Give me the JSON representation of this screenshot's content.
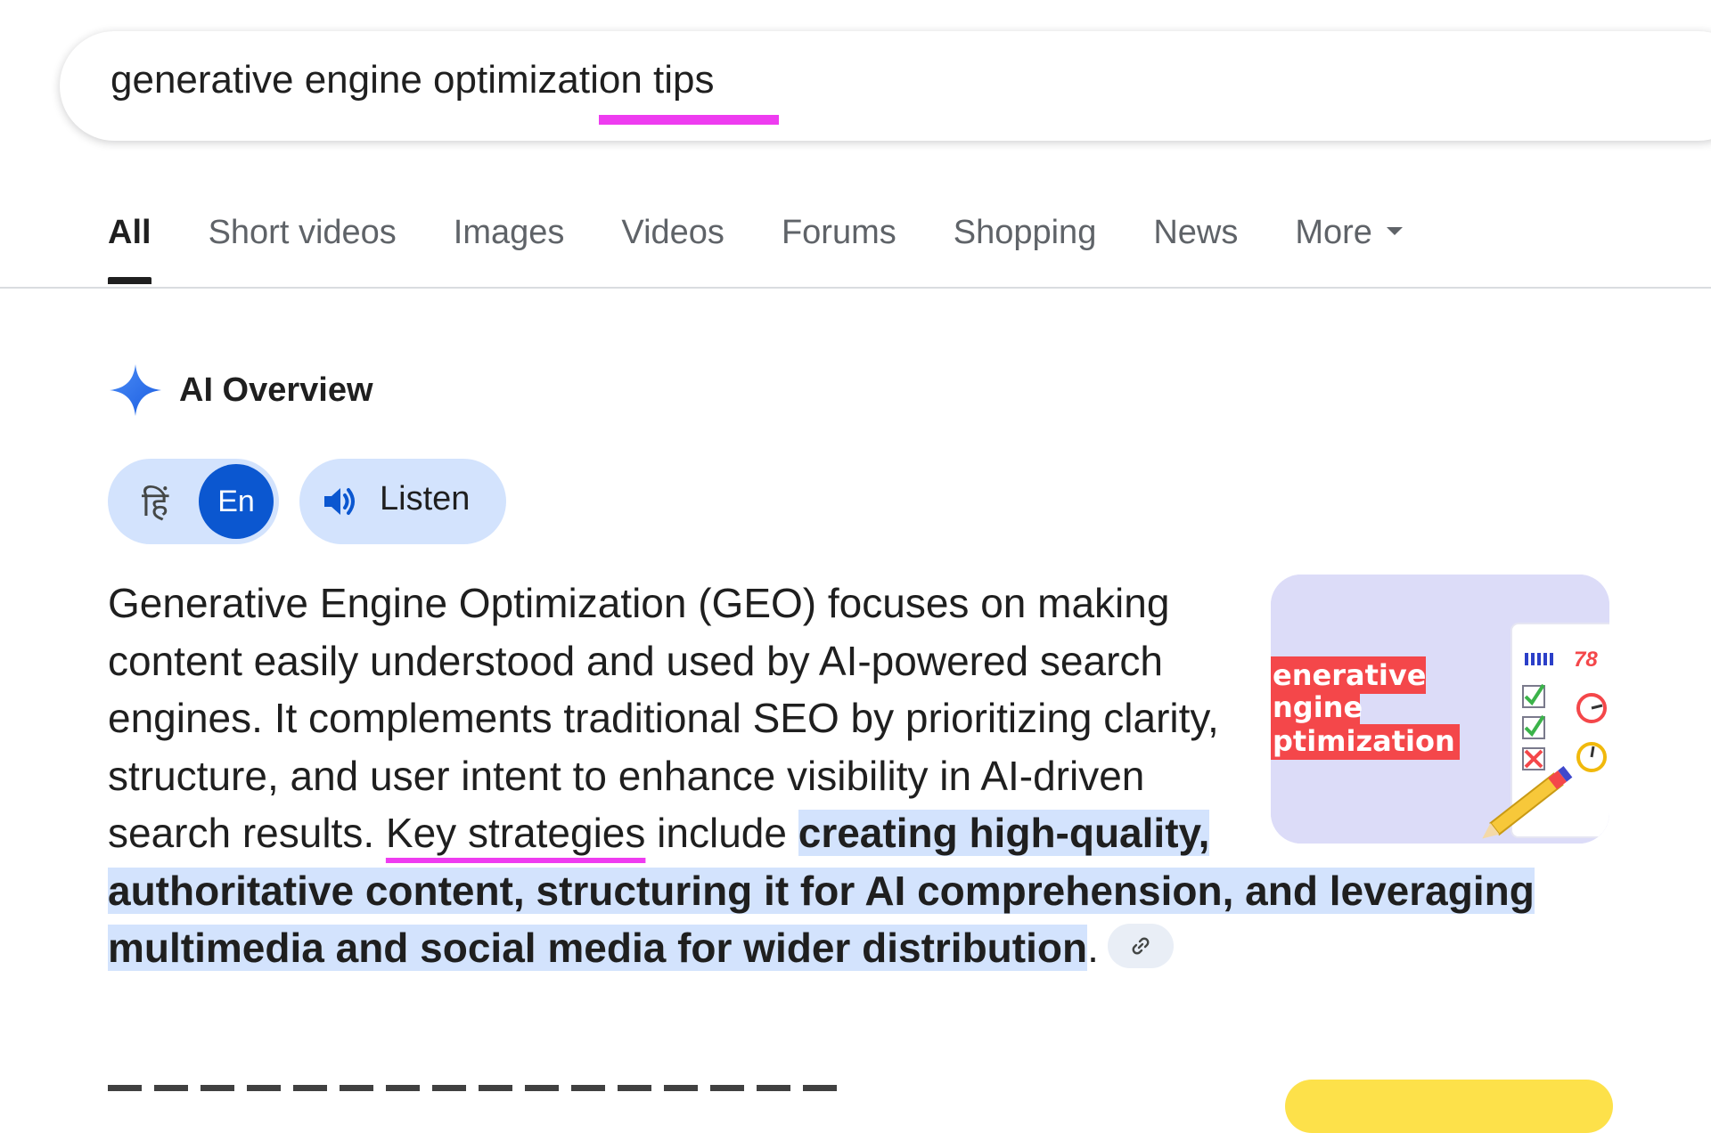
{
  "search": {
    "query": "generative engine optimization tips"
  },
  "tabs": [
    {
      "label": "All",
      "active": true
    },
    {
      "label": "Short videos"
    },
    {
      "label": "Images"
    },
    {
      "label": "Videos"
    },
    {
      "label": "Forums"
    },
    {
      "label": "Shopping"
    },
    {
      "label": "News"
    },
    {
      "label": "More"
    }
  ],
  "ai_overview": {
    "title": "AI Overview",
    "language": {
      "hindi_label": "हिं",
      "english_label": "En",
      "selected": "En"
    },
    "listen_label": "Listen",
    "text_intro": "Generative Engine Optimization (GEO) focuses on making content easily understood and used by AI-powered search engines. It complements traditional SEO by prioritizing clarity, structure, and user intent to enhance visibility in AI-driven search results. ",
    "text_key": "Key strategies",
    "text_mid": " include ",
    "text_highlight": "creating high-quality, authoritative content, structuring it for AI comprehension, and leveraging multimedia and social media for wider distribution",
    "text_end": ".",
    "thumbnail": {
      "lines": [
        "enerative",
        "ngine",
        "ptimization"
      ],
      "score": "78"
    }
  },
  "colors": {
    "accent_blue": "#0b57d0",
    "pill_blue": "#d3e3fd",
    "highlight_underline": "#ee3cf0",
    "thumb_red": "#f4474a"
  }
}
